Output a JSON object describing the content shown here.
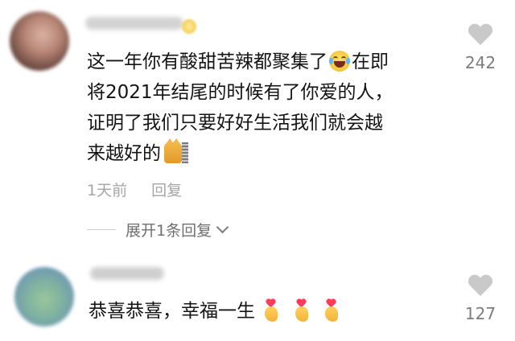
{
  "comments": [
    {
      "username": "",
      "text_lines": [
        "这一年你有酸甜苦辣都聚集了",
        "在即",
        "将2021年结尾的时候有了你爱的人，",
        "证明了我们只要好好生活我们就会越",
        "来越好的"
      ],
      "time": "1天前",
      "reply_label": "回复",
      "likes": "242",
      "expand_replies_label": "展开1条回复"
    },
    {
      "username": "",
      "text": "恭喜恭喜，幸福一生",
      "likes": "127"
    }
  ],
  "icons": {
    "like": "heart-icon",
    "expand": "chevron-down-icon",
    "emoji1": "laughing-crying-emoji-icon",
    "emoji2": "cat-emoji-icon",
    "emoji3": "finger-heart-emoji-icon"
  },
  "colors": {
    "text": "#141414",
    "meta": "#a6a6a6",
    "like_icon": "#c9c9c9"
  }
}
